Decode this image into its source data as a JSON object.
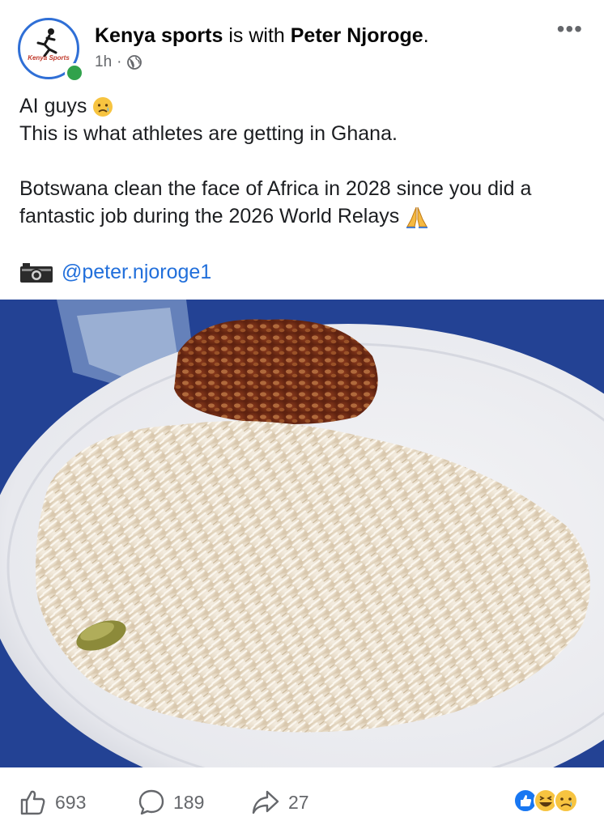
{
  "post": {
    "page_name": "Kenya sports",
    "with_text": " is with ",
    "tagged": "Peter Njoroge",
    "tagged_suffix": ".",
    "time": "1h",
    "separator": "·",
    "avatar_text": "Kenya Sports",
    "lines": [
      "AI guys",
      "This is what athletes are getting in Ghana.",
      "Botswana clean the face of Africa in 2028 since you did a fantastic job during the 2026 World Relays"
    ],
    "photo_credit": "@peter.njoroge1"
  },
  "stats": {
    "likes": "693",
    "comments": "189",
    "shares": "27"
  },
  "colors": {
    "online": "#31a24c",
    "link": "#216fdb",
    "avatar_border": "#2f6fd6",
    "tablecloth": "#27479c"
  },
  "icons": [
    "globe-icon",
    "more-icon",
    "camera-icon",
    "like-icon",
    "comment-icon",
    "share-icon",
    "sad-emoji-icon",
    "pray-emoji-icon"
  ]
}
